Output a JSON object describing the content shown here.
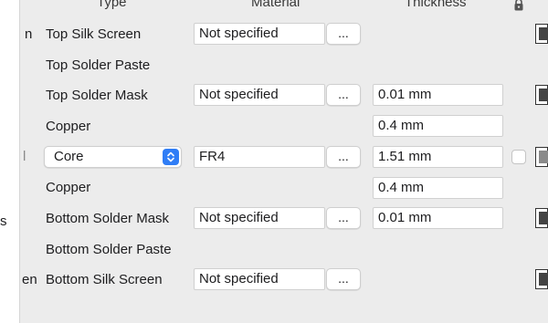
{
  "headers": {
    "type": "Type",
    "material": "Material",
    "thickness": "Thickness"
  },
  "left_panel": {
    "frag1": "n",
    "frag2": "l",
    "frag3": "s",
    "frag4": "en"
  },
  "rows": [
    {
      "label": "Top Silk Screen",
      "material": "Not specified",
      "dots": "..."
    },
    {
      "label": "Top Solder Paste"
    },
    {
      "label": "Top Solder Mask",
      "material": "Not specified",
      "dots": "...",
      "thickness": "0.01 mm"
    },
    {
      "label": "Copper",
      "thickness": "0.4 mm"
    },
    {
      "select_value": "Core",
      "material": "FR4",
      "dots": "...",
      "thickness": "1.51 mm"
    },
    {
      "label": "Copper",
      "thickness": "0.4 mm"
    },
    {
      "label": "Bottom Solder Mask",
      "material": "Not specified",
      "dots": "...",
      "thickness": "0.01 mm"
    },
    {
      "label": "Bottom Solder Paste"
    },
    {
      "label": "Bottom Silk Screen",
      "material": "Not specified",
      "dots": "..."
    }
  ],
  "icons": {
    "lock": "lock-icon",
    "stepper": "chevron-updown-icon"
  },
  "colors": {
    "accent": "#2f7df6",
    "swatch": "#444444"
  }
}
